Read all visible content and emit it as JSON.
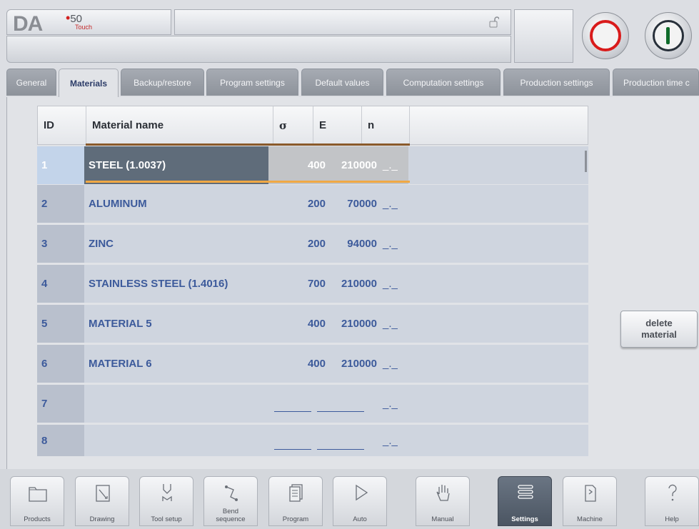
{
  "header": {
    "logo_brand": "DA",
    "logo_model": "50",
    "logo_sub": "Touch"
  },
  "tabs": [
    {
      "label": "General",
      "active": false
    },
    {
      "label": "Materials",
      "active": true
    },
    {
      "label": "Backup/restore",
      "active": false
    },
    {
      "label": "Program settings",
      "active": false
    },
    {
      "label": "Default values",
      "active": false
    },
    {
      "label": "Computation settings",
      "active": false
    },
    {
      "label": "Production settings",
      "active": false
    },
    {
      "label": "Production time c",
      "active": false
    }
  ],
  "table": {
    "columns": {
      "id": "ID",
      "name": "Material name",
      "sigma": "σ",
      "e": "E",
      "n": "n"
    },
    "rows": [
      {
        "id": "1",
        "name": "STEEL (1.0037)",
        "sigma": "400",
        "e": "210000",
        "n": "_._",
        "selected": true
      },
      {
        "id": "2",
        "name": "ALUMINUM",
        "sigma": "200",
        "e": "70000",
        "n": "_._"
      },
      {
        "id": "3",
        "name": "ZINC",
        "sigma": "200",
        "e": "94000",
        "n": "_._"
      },
      {
        "id": "4",
        "name": "STAINLESS STEEL (1.4016)",
        "sigma": "700",
        "e": "210000",
        "n": "_._"
      },
      {
        "id": "5",
        "name": "MATERIAL 5",
        "sigma": "400",
        "e": "210000",
        "n": "_._"
      },
      {
        "id": "6",
        "name": "MATERIAL 6",
        "sigma": "400",
        "e": "210000",
        "n": "_._"
      },
      {
        "id": "7",
        "name": "",
        "sigma": "",
        "e": "",
        "n": "_._"
      },
      {
        "id": "8",
        "name": "",
        "sigma": "",
        "e": "",
        "n": "_._"
      }
    ]
  },
  "actions": {
    "delete_line1": "delete",
    "delete_line2": "material"
  },
  "toolbar": [
    {
      "label": "Products",
      "icon": "folder-icon"
    },
    {
      "label": "Drawing",
      "icon": "pencil-icon"
    },
    {
      "label": "Tool setup",
      "icon": "tool-icon"
    },
    {
      "label": "Bend\nsequence",
      "icon": "bend-sequence-icon"
    },
    {
      "label": "Program",
      "icon": "program-icon"
    },
    {
      "label": "Auto",
      "icon": "play-icon"
    },
    {
      "label": "Manual",
      "icon": "hand-icon"
    },
    {
      "label": "Settings",
      "icon": "settings-list-icon",
      "active": true
    },
    {
      "label": "Machine",
      "icon": "machine-icon"
    },
    {
      "label": "Help",
      "icon": "help-icon"
    }
  ],
  "colors": {
    "accent_text": "#3c5a9b",
    "stop": "#d91b1b",
    "start": "#0f6b2a",
    "selection_underline": "#f0a844"
  }
}
